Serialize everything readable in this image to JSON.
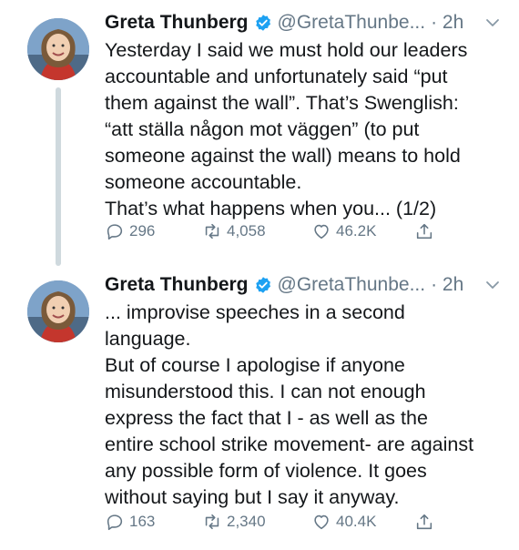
{
  "tweets": [
    {
      "author_name": "Greta Thunberg",
      "handle": "@GretaThunbe...",
      "time": "· 2h",
      "lines": [
        "Yesterday I said we must hold our leaders",
        "accountable and unfortunately said “put",
        "them against the wall”. That’s Swenglish:",
        "“att ställa någon mot väggen” (to put",
        "someone against the wall) means to hold",
        "someone accountable.",
        "That’s what happens when you... (1/2)"
      ],
      "replies": "296",
      "retweets": "4,058",
      "likes": "46.2K"
    },
    {
      "author_name": "Greta Thunberg",
      "handle": "@GretaThunbe...",
      "time": "· 2h",
      "lines": [
        "... improvise speeches in a second",
        "language.",
        "But of course I apologise if anyone",
        "misunderstood this. I can not enough",
        "express the fact that I - as well as the",
        "entire school strike movement- are against",
        "any possible form of violence. It goes",
        "without saying but I say it anyway."
      ],
      "replies": "163",
      "retweets": "2,340",
      "likes": "40.4K"
    }
  ],
  "colors": {
    "text": "#14171a",
    "secondary": "#657786",
    "verified": "#1da1f2",
    "thread_line": "#cfd9de"
  },
  "icons": [
    "verified-badge-icon",
    "chevron-down-icon",
    "reply-icon",
    "retweet-icon",
    "like-icon",
    "share-icon"
  ]
}
